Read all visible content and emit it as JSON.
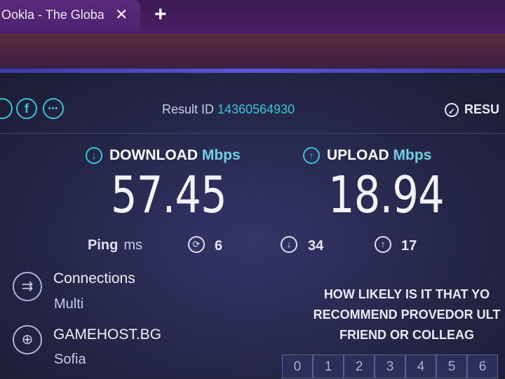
{
  "browser": {
    "tab_title": "Ookla - The Globa",
    "tab_close": "✕",
    "new_tab": "+"
  },
  "header": {
    "social": [
      {
        "name": "twitter-icon",
        "glyph": ""
      },
      {
        "name": "facebook-icon",
        "glyph": "f"
      },
      {
        "name": "more-icon",
        "glyph": "•••"
      }
    ],
    "result_label": "Result ID",
    "result_id": "14360564930",
    "results_button": "RESU"
  },
  "download": {
    "label": "DOWNLOAD",
    "unit": "Mbps",
    "value": "57.45"
  },
  "upload": {
    "label": "UPLOAD",
    "unit": "Mbps",
    "value": "18.94"
  },
  "ping": {
    "label": "Ping",
    "unit": "ms",
    "idle": "6",
    "download": "34",
    "upload": "17"
  },
  "connections": {
    "title": "Connections",
    "value": "Multi"
  },
  "server": {
    "title": "GAMEHOST.BG",
    "location": "Sofia"
  },
  "survey": {
    "line1": "HOW LIKELY IS IT THAT YO",
    "line2": "RECOMMEND PROVEDOR ULT",
    "line3": "FRIEND OR COLLEAG",
    "scale": [
      "0",
      "1",
      "2",
      "3",
      "4",
      "5",
      "6"
    ]
  },
  "colors": {
    "accent": "#39c5d6",
    "background": "#252749",
    "tab_bar": "#4a1e66"
  }
}
